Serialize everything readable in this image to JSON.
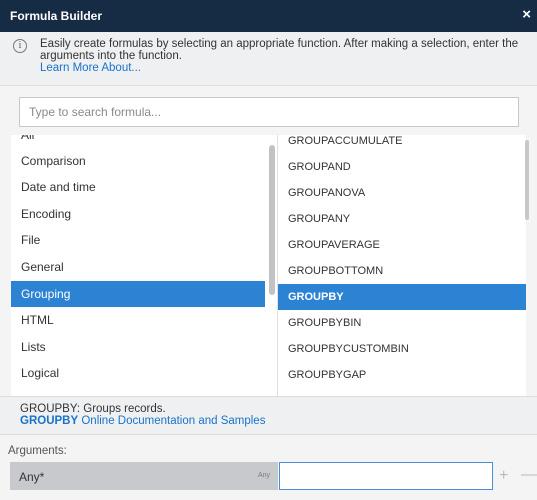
{
  "window": {
    "title": "Formula Builder",
    "close_glyph": "×"
  },
  "info": {
    "icon": "i",
    "text": "Easily create formulas by selecting an appropriate function. After making a selection, enter the arguments into the function.",
    "learn_more": "Learn More About..."
  },
  "search": {
    "placeholder": "Type to search formula..."
  },
  "categories": [
    "All",
    "Comparison",
    "Date and time",
    "Encoding",
    "File",
    "General",
    "Grouping",
    "HTML",
    "Lists",
    "Logical"
  ],
  "categories_selected": "Grouping",
  "functions": [
    "GROUPACCUMULATE",
    "GROUPAND",
    "GROUPANOVA",
    "GROUPANY",
    "GROUPAVERAGE",
    "GROUPBOTTOMN",
    "GROUPBY",
    "GROUPBYBIN",
    "GROUPBYCUSTOMBIN",
    "GROUPBYGAP"
  ],
  "functions_selected": "GROUPBY",
  "description": {
    "summary": "GROUPBY: Groups records.",
    "doc_name": "GROUPBY",
    "doc_link": " Online Documentation and Samples"
  },
  "arguments": {
    "label": "Arguments:",
    "rows": [
      {
        "name": "Any*",
        "type": "Any",
        "value": ""
      }
    ],
    "add_glyph": "+",
    "remove_glyph": "—"
  },
  "colors": {
    "titlebar": "#162b44",
    "selected": "#2d83d3",
    "link": "#1a73c8"
  }
}
